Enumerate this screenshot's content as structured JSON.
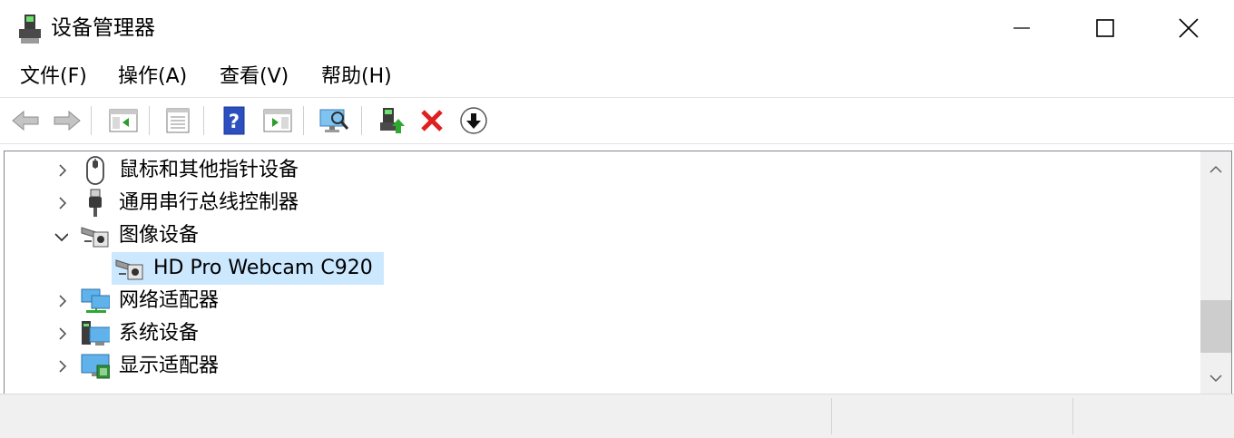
{
  "window": {
    "title": "设备管理器"
  },
  "menu": [
    {
      "label": "文件(F)"
    },
    {
      "label": "操作(A)"
    },
    {
      "label": "查看(V)"
    },
    {
      "label": "帮助(H)"
    }
  ],
  "tree": {
    "items": [
      {
        "label": "鼠标和其他指针设备",
        "icon": "mouse-icon",
        "expanded": false
      },
      {
        "label": "通用串行总线控制器",
        "icon": "usb-icon",
        "expanded": false
      },
      {
        "label": "图像设备",
        "icon": "camera-icon",
        "expanded": true
      },
      {
        "label": "HD Pro Webcam C920",
        "icon": "camera-icon",
        "selected": true
      },
      {
        "label": "网络适配器",
        "icon": "network-adapter-icon",
        "expanded": false
      },
      {
        "label": "系统设备",
        "icon": "system-device-icon",
        "expanded": false
      },
      {
        "label": "显示适配器",
        "icon": "display-adapter-icon",
        "expanded": false
      }
    ]
  },
  "colors": {
    "selection": "#cce8ff",
    "accent": "#0078d7"
  }
}
